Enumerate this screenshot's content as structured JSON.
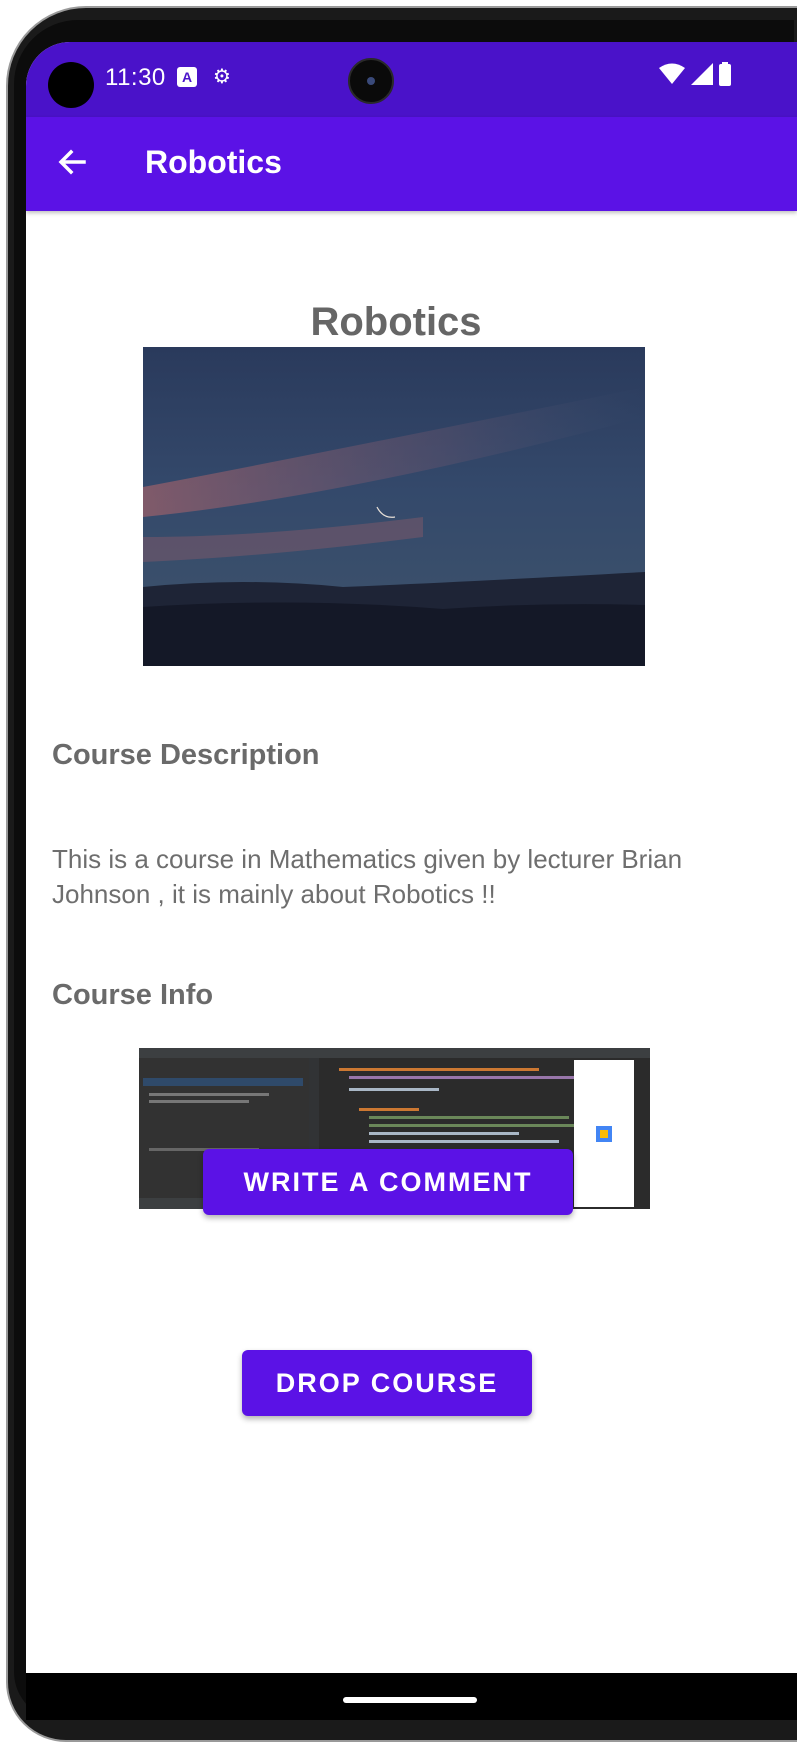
{
  "status_bar": {
    "time": "11:30",
    "a_badge": "A",
    "icons": [
      "wifi-icon",
      "signal-icon",
      "battery-icon"
    ]
  },
  "app_bar": {
    "back_icon": "arrow-left-icon",
    "title": "Robotics"
  },
  "course": {
    "title": "Robotics",
    "description_heading": "Course Description",
    "description_text": "This is a course in Mathematics given by lecturer Brian Johnson , it is mainly about Robotics !!",
    "info_heading": "Course Info"
  },
  "buttons": {
    "write_comment": "WRITE A COMMENT",
    "drop_course": "DROP COURSE"
  },
  "colors": {
    "primary": "#5b12e6",
    "status_bar": "#4a12c9",
    "text_gray": "#6a6a6a"
  }
}
